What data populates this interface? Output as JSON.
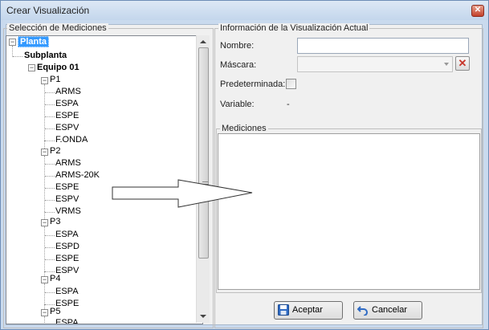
{
  "window": {
    "title": "Crear Visualización",
    "close": "✕"
  },
  "left_group": {
    "legend": "Selección de Mediciones"
  },
  "tree": {
    "planta": "Planta",
    "subplanta": "Subplanta",
    "equipo": "Equipo 01",
    "p1": {
      "label": "P1",
      "items": [
        "ARMS",
        "ESPA",
        "ESPE",
        "ESPV",
        "F.ONDA"
      ]
    },
    "p2": {
      "label": "P2",
      "items": [
        "ARMS",
        "ARMS-20K",
        "ESPE",
        "ESPV",
        "VRMS"
      ]
    },
    "p3": {
      "label": "P3",
      "items": [
        "ESPA",
        "ESPD",
        "ESPE",
        "ESPV"
      ]
    },
    "p4": {
      "label": "P4",
      "items": [
        "ESPA",
        "ESPE"
      ]
    },
    "p5": {
      "label": "P5",
      "items": [
        "ESPA"
      ]
    }
  },
  "right_group": {
    "legend": "Información de la Visualización Actual",
    "nombre_label": "Nombre:",
    "nombre_value": "",
    "mascara_label": "Máscara:",
    "mascara_value": "",
    "predeterminada_label": "Predeterminada:",
    "predeterminada_checked": false,
    "variable_label": "Variable:",
    "variable_value": "-"
  },
  "mediciones": {
    "legend": "Mediciones"
  },
  "buttons": {
    "aceptar": "Aceptar",
    "cancelar": "Cancelar"
  },
  "colors": {
    "selection": "#3399ff",
    "titlebar": "#c9daee",
    "close": "#c3402a"
  }
}
